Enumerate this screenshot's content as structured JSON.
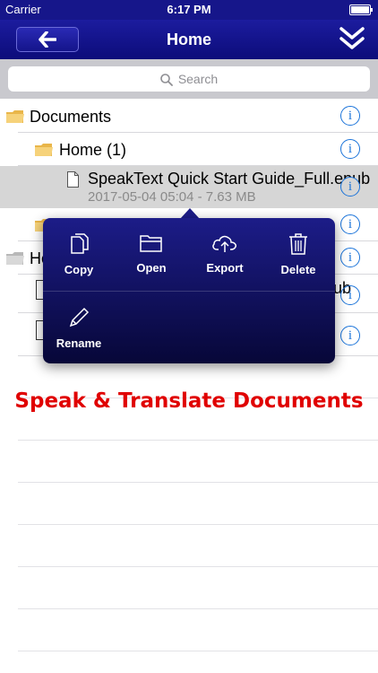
{
  "status_bar": {
    "carrier": "Carrier",
    "time": "6:17 PM"
  },
  "nav": {
    "title": "Home",
    "back_icon": "arrow-left-icon",
    "menu_icon": "double-chevron-down-icon"
  },
  "search": {
    "placeholder": "Search"
  },
  "tree": {
    "documents_label": "Documents",
    "home_label": "Home (1)",
    "file_name": "SpeakText Quick Start Guide_Full.epub",
    "file_meta": "2017-05-04 05:04 - 7.63 MB",
    "partial_label_left": "Ho",
    "partial_label_right": "ub",
    "info_glyph": "i"
  },
  "popover": {
    "copy": "Copy",
    "open": "Open",
    "export": "Export",
    "delete": "Delete",
    "rename": "Rename"
  },
  "promo_text": "Speak & Translate Documents",
  "colors": {
    "nav": "#16168a",
    "accent": "#1a73d9",
    "promo": "#e00000"
  }
}
